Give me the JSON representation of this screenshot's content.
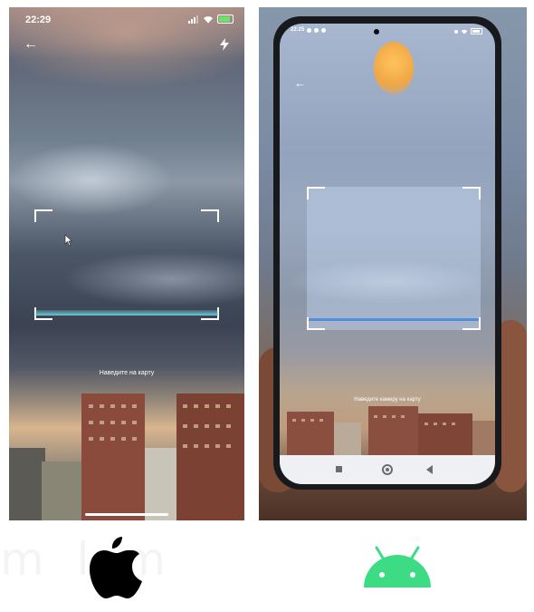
{
  "ios_screen": {
    "time": "22:29",
    "hint": "Наведите на карту"
  },
  "android_screen": {
    "time": "22:25",
    "hint": "Наведите камеру на карту"
  },
  "watermark_text": "m l m",
  "colors": {
    "ios_scan_line": "#7fd9e6",
    "android_scan_line": "#4f8ee0",
    "android_brand": "#3ddc84",
    "apple_logo": "#000000"
  },
  "icons": {
    "ios": [
      "signal-icon",
      "wifi-icon",
      "battery-icon",
      "back-arrow-icon",
      "flash-icon"
    ],
    "android": [
      "back-arrow-icon",
      "recents-icon",
      "home-icon",
      "back-icon"
    ]
  },
  "logos": [
    "apple-logo",
    "android-logo"
  ]
}
